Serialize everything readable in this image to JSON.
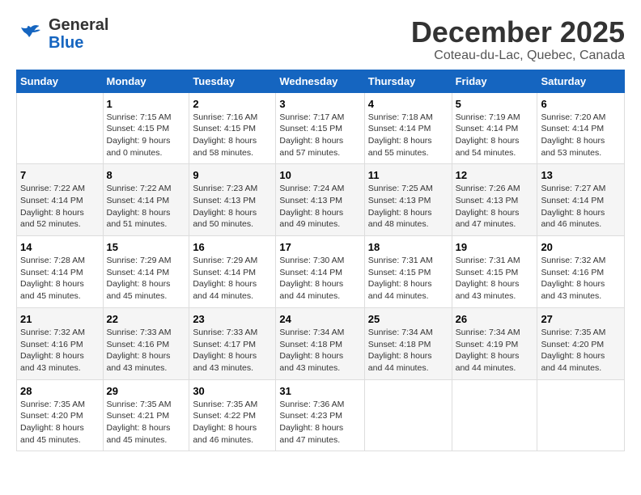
{
  "logo": {
    "general": "General",
    "blue": "Blue"
  },
  "title": "December 2025",
  "subtitle": "Coteau-du-Lac, Quebec, Canada",
  "days_header": [
    "Sunday",
    "Monday",
    "Tuesday",
    "Wednesday",
    "Thursday",
    "Friday",
    "Saturday"
  ],
  "weeks": [
    [
      {
        "day": "",
        "info": ""
      },
      {
        "day": "1",
        "info": "Sunrise: 7:15 AM\nSunset: 4:15 PM\nDaylight: 9 hours\nand 0 minutes."
      },
      {
        "day": "2",
        "info": "Sunrise: 7:16 AM\nSunset: 4:15 PM\nDaylight: 8 hours\nand 58 minutes."
      },
      {
        "day": "3",
        "info": "Sunrise: 7:17 AM\nSunset: 4:15 PM\nDaylight: 8 hours\nand 57 minutes."
      },
      {
        "day": "4",
        "info": "Sunrise: 7:18 AM\nSunset: 4:14 PM\nDaylight: 8 hours\nand 55 minutes."
      },
      {
        "day": "5",
        "info": "Sunrise: 7:19 AM\nSunset: 4:14 PM\nDaylight: 8 hours\nand 54 minutes."
      },
      {
        "day": "6",
        "info": "Sunrise: 7:20 AM\nSunset: 4:14 PM\nDaylight: 8 hours\nand 53 minutes."
      }
    ],
    [
      {
        "day": "7",
        "info": "Sunrise: 7:22 AM\nSunset: 4:14 PM\nDaylight: 8 hours\nand 52 minutes."
      },
      {
        "day": "8",
        "info": "Sunrise: 7:22 AM\nSunset: 4:14 PM\nDaylight: 8 hours\nand 51 minutes."
      },
      {
        "day": "9",
        "info": "Sunrise: 7:23 AM\nSunset: 4:13 PM\nDaylight: 8 hours\nand 50 minutes."
      },
      {
        "day": "10",
        "info": "Sunrise: 7:24 AM\nSunset: 4:13 PM\nDaylight: 8 hours\nand 49 minutes."
      },
      {
        "day": "11",
        "info": "Sunrise: 7:25 AM\nSunset: 4:13 PM\nDaylight: 8 hours\nand 48 minutes."
      },
      {
        "day": "12",
        "info": "Sunrise: 7:26 AM\nSunset: 4:13 PM\nDaylight: 8 hours\nand 47 minutes."
      },
      {
        "day": "13",
        "info": "Sunrise: 7:27 AM\nSunset: 4:14 PM\nDaylight: 8 hours\nand 46 minutes."
      }
    ],
    [
      {
        "day": "14",
        "info": "Sunrise: 7:28 AM\nSunset: 4:14 PM\nDaylight: 8 hours\nand 45 minutes."
      },
      {
        "day": "15",
        "info": "Sunrise: 7:29 AM\nSunset: 4:14 PM\nDaylight: 8 hours\nand 45 minutes."
      },
      {
        "day": "16",
        "info": "Sunrise: 7:29 AM\nSunset: 4:14 PM\nDaylight: 8 hours\nand 44 minutes."
      },
      {
        "day": "17",
        "info": "Sunrise: 7:30 AM\nSunset: 4:14 PM\nDaylight: 8 hours\nand 44 minutes."
      },
      {
        "day": "18",
        "info": "Sunrise: 7:31 AM\nSunset: 4:15 PM\nDaylight: 8 hours\nand 44 minutes."
      },
      {
        "day": "19",
        "info": "Sunrise: 7:31 AM\nSunset: 4:15 PM\nDaylight: 8 hours\nand 43 minutes."
      },
      {
        "day": "20",
        "info": "Sunrise: 7:32 AM\nSunset: 4:16 PM\nDaylight: 8 hours\nand 43 minutes."
      }
    ],
    [
      {
        "day": "21",
        "info": "Sunrise: 7:32 AM\nSunset: 4:16 PM\nDaylight: 8 hours\nand 43 minutes."
      },
      {
        "day": "22",
        "info": "Sunrise: 7:33 AM\nSunset: 4:16 PM\nDaylight: 8 hours\nand 43 minutes."
      },
      {
        "day": "23",
        "info": "Sunrise: 7:33 AM\nSunset: 4:17 PM\nDaylight: 8 hours\nand 43 minutes."
      },
      {
        "day": "24",
        "info": "Sunrise: 7:34 AM\nSunset: 4:18 PM\nDaylight: 8 hours\nand 43 minutes."
      },
      {
        "day": "25",
        "info": "Sunrise: 7:34 AM\nSunset: 4:18 PM\nDaylight: 8 hours\nand 44 minutes."
      },
      {
        "day": "26",
        "info": "Sunrise: 7:34 AM\nSunset: 4:19 PM\nDaylight: 8 hours\nand 44 minutes."
      },
      {
        "day": "27",
        "info": "Sunrise: 7:35 AM\nSunset: 4:20 PM\nDaylight: 8 hours\nand 44 minutes."
      }
    ],
    [
      {
        "day": "28",
        "info": "Sunrise: 7:35 AM\nSunset: 4:20 PM\nDaylight: 8 hours\nand 45 minutes."
      },
      {
        "day": "29",
        "info": "Sunrise: 7:35 AM\nSunset: 4:21 PM\nDaylight: 8 hours\nand 45 minutes."
      },
      {
        "day": "30",
        "info": "Sunrise: 7:35 AM\nSunset: 4:22 PM\nDaylight: 8 hours\nand 46 minutes."
      },
      {
        "day": "31",
        "info": "Sunrise: 7:36 AM\nSunset: 4:23 PM\nDaylight: 8 hours\nand 47 minutes."
      },
      {
        "day": "",
        "info": ""
      },
      {
        "day": "",
        "info": ""
      },
      {
        "day": "",
        "info": ""
      }
    ]
  ]
}
